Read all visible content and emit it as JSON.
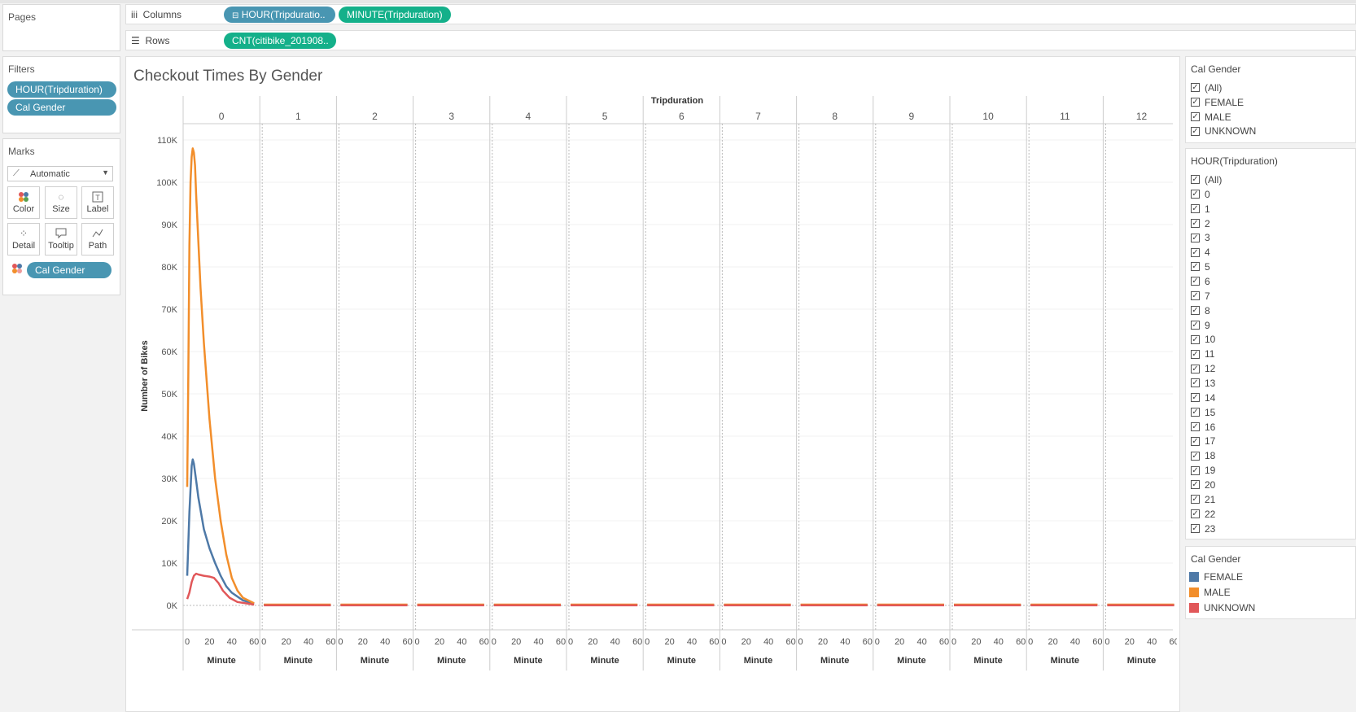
{
  "left": {
    "pages_title": "Pages",
    "filters_title": "Filters",
    "filters": [
      "HOUR(Tripduration)",
      "Cal Gender"
    ],
    "marks_title": "Marks",
    "mark_type": "Automatic",
    "mark_buttons": [
      "Color",
      "Size",
      "Label",
      "Detail",
      "Tooltip",
      "Path"
    ],
    "marks_field": "Cal Gender"
  },
  "shelves": {
    "columns_label": "Columns",
    "columns_pills": [
      "HOUR(Tripduratio..",
      "MINUTE(Tripduration)"
    ],
    "rows_label": "Rows",
    "rows_pills": [
      "CNT(citibike_201908.."
    ]
  },
  "filter_gender": {
    "title": "Cal Gender",
    "items": [
      "(All)",
      "FEMALE",
      "MALE",
      "UNKNOWN"
    ]
  },
  "filter_hour": {
    "title": "HOUR(Tripduration)",
    "items": [
      "(All)",
      "0",
      "1",
      "2",
      "3",
      "4",
      "5",
      "6",
      "7",
      "8",
      "9",
      "10",
      "11",
      "12",
      "13",
      "14",
      "15",
      "16",
      "17",
      "18",
      "19",
      "20",
      "21",
      "22",
      "23"
    ]
  },
  "legend": {
    "title": "Cal Gender",
    "items": [
      {
        "label": "FEMALE",
        "color": "#4e79a7"
      },
      {
        "label": "MALE",
        "color": "#f28e2b"
      },
      {
        "label": "UNKNOWN",
        "color": "#e15759"
      }
    ]
  },
  "chart_data": {
    "type": "line",
    "title": "Checkout Times By Gender",
    "header": "Tripduration",
    "panels": [
      "0",
      "1",
      "2",
      "3",
      "4",
      "5",
      "6",
      "7",
      "8",
      "9",
      "10",
      "11",
      "12"
    ],
    "xlabel": "Minute",
    "ylabel": "Number of Bikes",
    "xticks": [
      0,
      20,
      40,
      60
    ],
    "yticks": [
      "0K",
      "10K",
      "20K",
      "30K",
      "40K",
      "50K",
      "60K",
      "70K",
      "80K",
      "90K",
      "100K",
      "110K"
    ],
    "ylim": [
      0,
      110000
    ],
    "xlim": [
      0,
      60
    ],
    "series": [
      {
        "name": "FEMALE",
        "color": "#4e79a7",
        "panel0": [
          [
            0,
            7000
          ],
          [
            2,
            22000
          ],
          [
            4,
            33000
          ],
          [
            5,
            34500
          ],
          [
            6,
            33500
          ],
          [
            8,
            29500
          ],
          [
            10,
            25500
          ],
          [
            15,
            18000
          ],
          [
            20,
            13500
          ],
          [
            25,
            10000
          ],
          [
            30,
            7000
          ],
          [
            35,
            4500
          ],
          [
            40,
            3000
          ],
          [
            50,
            1200
          ],
          [
            60,
            400
          ]
        ],
        "other_panels": 150
      },
      {
        "name": "MALE",
        "color": "#f28e2b",
        "panel0": [
          [
            0,
            28000
          ],
          [
            1,
            55000
          ],
          [
            2,
            85000
          ],
          [
            3,
            100000
          ],
          [
            4,
            106000
          ],
          [
            5,
            108000
          ],
          [
            6,
            107000
          ],
          [
            7,
            104000
          ],
          [
            8,
            97000
          ],
          [
            10,
            86000
          ],
          [
            12,
            75000
          ],
          [
            15,
            62000
          ],
          [
            20,
            44000
          ],
          [
            25,
            30000
          ],
          [
            30,
            20000
          ],
          [
            35,
            12000
          ],
          [
            40,
            6500
          ],
          [
            45,
            3500
          ],
          [
            50,
            1800
          ],
          [
            60,
            500
          ]
        ],
        "other_panels": 200
      },
      {
        "name": "UNKNOWN",
        "color": "#e15759",
        "panel0": [
          [
            0,
            1500
          ],
          [
            2,
            3000
          ],
          [
            4,
            5500
          ],
          [
            6,
            7000
          ],
          [
            8,
            7500
          ],
          [
            10,
            7300
          ],
          [
            15,
            7000
          ],
          [
            20,
            6800
          ],
          [
            24,
            6500
          ],
          [
            28,
            5300
          ],
          [
            32,
            3500
          ],
          [
            38,
            1800
          ],
          [
            45,
            800
          ],
          [
            60,
            200
          ]
        ],
        "other_panels": 20
      }
    ]
  }
}
